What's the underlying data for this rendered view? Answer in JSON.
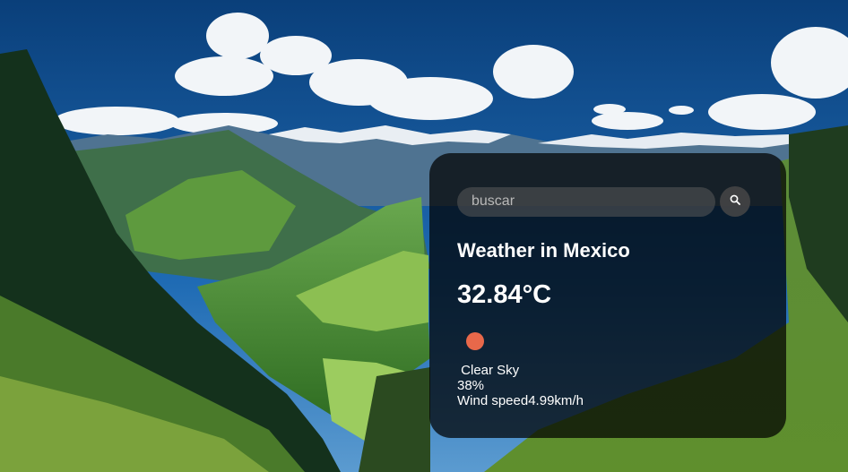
{
  "search": {
    "placeholder": "buscar",
    "value": ""
  },
  "weather": {
    "title": "Weather in Mexico",
    "temperature": "32.84°C",
    "description": " Clear Sky",
    "humidity": "38%",
    "wind": "Wind speed4.99km/h",
    "icon": "sun-icon"
  },
  "colors": {
    "card_background": "#000000b8",
    "icon_color": "#e8684a",
    "text": "#ffffff"
  },
  "icons": {
    "search": "search-icon"
  }
}
